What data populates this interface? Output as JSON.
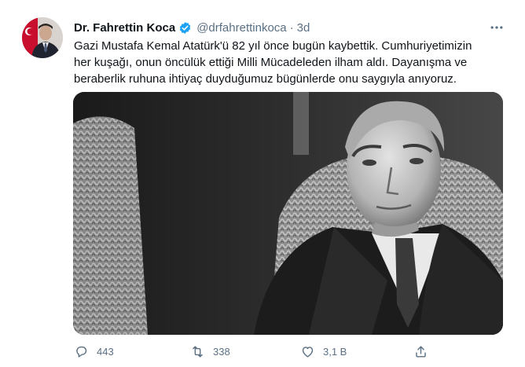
{
  "tweet": {
    "author_name": "Dr. Fahrettin Koca",
    "handle": "@drfahrettinkoca",
    "separator": "·",
    "time": "3d",
    "text_lines": [
      "Gazi Mustafa Kemal Atatürk'ü 82 yıl önce bugün kaybettik. Cumhuriyetimizin",
      "her kuşağı, onun öncülük ettiği Milli Mücadeleden ilham aldı. Dayanışma ve",
      "beraberlik ruhuna ihtiyaç duyduğumuz bügünlerde onu saygıyla anıyoruz."
    ]
  },
  "actions": {
    "reply_count": "443",
    "retweet_count": "338",
    "like_count": "3,1 B"
  },
  "icons": {
    "verified": "verified-badge-icon",
    "more": "more-horizontal-icon",
    "reply": "reply-icon",
    "retweet": "retweet-icon",
    "like": "heart-icon",
    "share": "share-icon"
  },
  "colors": {
    "text": "#0f1419",
    "secondary": "#5b7083",
    "verified": "#1da1f2"
  }
}
